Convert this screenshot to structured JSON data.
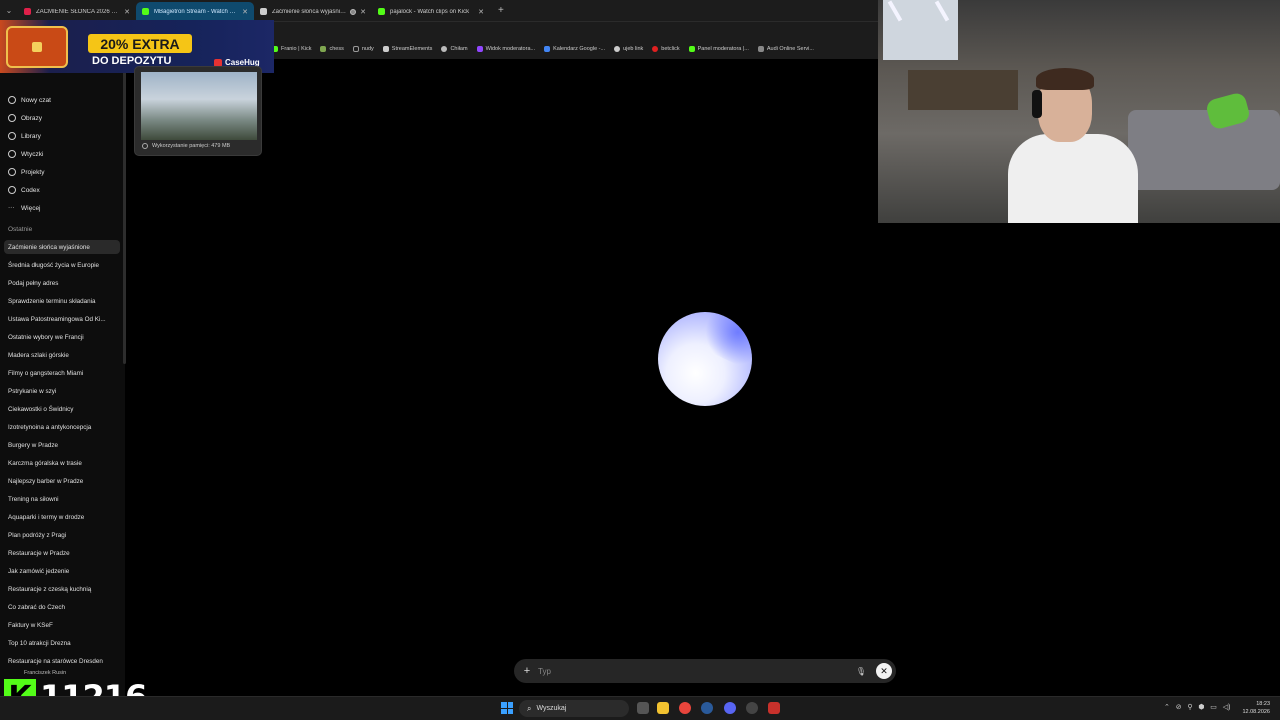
{
  "browser": {
    "tabs": [
      {
        "label": "ZAĆMIENIE SŁOŃCA 2026 NA ...",
        "favicon_color": "#e0204a",
        "active": false
      },
      {
        "label": "MBagietron Stream - Watch Li...",
        "favicon_color": "#53fc18",
        "active": true
      },
      {
        "label": "Zaćmienie słońca wyjaśnion...",
        "favicon_color": "#cccccc",
        "active": false
      },
      {
        "label": "pajalock - Watch clips on Kick",
        "favicon_color": "#53fc18",
        "active": false
      }
    ],
    "bookmarks": [
      {
        "label": "Franio | Kick",
        "color": "#53fc18"
      },
      {
        "label": "chess",
        "color": "#7fa650"
      },
      {
        "label": "nudy",
        "color": "#999999"
      },
      {
        "label": "StreamElements",
        "color": "#cccccc"
      },
      {
        "label": "Chiłam",
        "color": "#bbbbbb"
      },
      {
        "label": "Widok moderatora...",
        "color": "#9146ff"
      },
      {
        "label": "Kalendarz Google -...",
        "color": "#4285f4"
      },
      {
        "label": "ujeb link",
        "color": "#cccccc"
      },
      {
        "label": "betclick",
        "color": "#e02020"
      },
      {
        "label": "Panel moderatora |...",
        "color": "#53fc18"
      },
      {
        "label": "Audi Online Servi...",
        "color": "#888888"
      }
    ]
  },
  "ad": {
    "headline": "20% EXTRA",
    "subline": "DO DEPOZYTU",
    "brand": "CaseHug"
  },
  "preview": {
    "memory": "Wykorzystanie pamięci: 479 MB"
  },
  "sidebar": {
    "nav": [
      {
        "label": "Nowy czat",
        "icon": "edit-icon"
      },
      {
        "label": "Obrazy",
        "icon": "image-icon"
      },
      {
        "label": "Library",
        "icon": "library-icon"
      },
      {
        "label": "Wtyczki",
        "icon": "plugin-icon"
      },
      {
        "label": "Projekty",
        "icon": "folder-icon"
      },
      {
        "label": "Codex",
        "icon": "codex-icon"
      },
      {
        "label": "Więcej",
        "icon": "more-icon"
      }
    ],
    "recent_heading": "Ostatnie",
    "history": [
      "Zaćmienie słońca wyjaśnione",
      "Średnia długość życia w Europie",
      "Podaj pełny adres",
      "Sprawdzenie terminu składania",
      "Ustawa Patostreamingowa Od Ki...",
      "Ostatnie wybory we Francji",
      "Madera szlaki górskie",
      "Filmy o gangsterach Miami",
      "Pstrykanie w szyi",
      "Ciekawostki o Świdnicy",
      "Izotretynoina a antykoncepcja",
      "Burgery w Pradze",
      "Karczma góralska w trasie",
      "Najlepszy barber w Pradze",
      "Trening na siłowni",
      "Aquaparki i termy w drodze",
      "Plan podróży z Pragi",
      "Restauracje w Pradze",
      "Jak zamówić jedzenie",
      "Restauracje z czeską kuchnią",
      "Co zabrać do Czech",
      "Faktury w KSeF",
      "Top 10 atrakcji Drezna",
      "Restauracje na starówce Dresden"
    ],
    "user": "Franciszek Rusin"
  },
  "composer": {
    "placeholder": "Typ"
  },
  "kick_overlay": {
    "count": "11216"
  },
  "taskbar": {
    "search": "Wyszukaj",
    "time": "18:23",
    "date": "12.08.2026"
  }
}
